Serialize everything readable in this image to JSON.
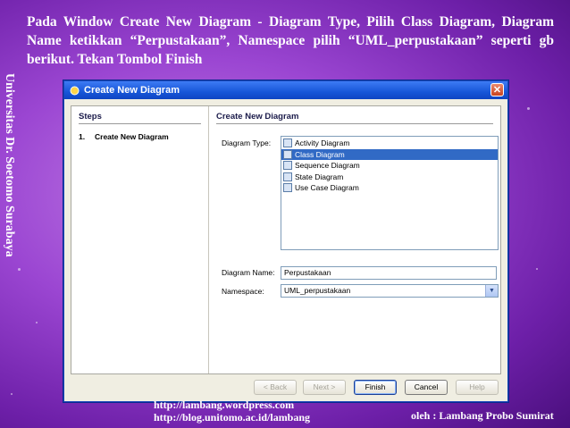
{
  "slide": {
    "heading": "Pada Window Create New Diagram - Diagram Type, Pilih Class Diagram, Diagram Name ketikkan “Perpustakaan”, Namespace pilih “UML_perpustakaan” seperti gb berikut. Tekan Tombol Finish",
    "side_text": "Universitas Dr. Soetomo Surabaya",
    "footer_link1": "http://lambang.wordpress.com",
    "footer_link2": "http://blog.unitomo.ac.id/lambang",
    "footer_author": "oleh : Lambang Probo Sumirat"
  },
  "dialog": {
    "title": "Create New Diagram",
    "close_glyph": "✕",
    "steps_title": "Steps",
    "steps": [
      {
        "num": "1.",
        "label": "Create New Diagram"
      }
    ],
    "main_title": "Create New Diagram",
    "diagram_type_label": "Diagram Type:",
    "diagram_types": [
      {
        "label": "Activity Diagram",
        "icon": "activity-diagram-icon"
      },
      {
        "label": "Class Diagram",
        "icon": "class-diagram-icon",
        "selected": true
      },
      {
        "label": "Sequence Diagram",
        "icon": "sequence-diagram-icon"
      },
      {
        "label": "State Diagram",
        "icon": "state-diagram-icon"
      },
      {
        "label": "Use Case Diagram",
        "icon": "use-case-diagram-icon"
      }
    ],
    "diagram_name_label": "Diagram Name:",
    "diagram_name_value": "Perpustakaan",
    "namespace_label": "Namespace:",
    "namespace_value": "UML_perpustakaan",
    "buttons": {
      "back": "< Back",
      "next": "Next >",
      "finish": "Finish",
      "cancel": "Cancel",
      "help": "Help"
    },
    "colors": {
      "title_bar": "#1756d8",
      "selection": "#316ac5"
    }
  }
}
